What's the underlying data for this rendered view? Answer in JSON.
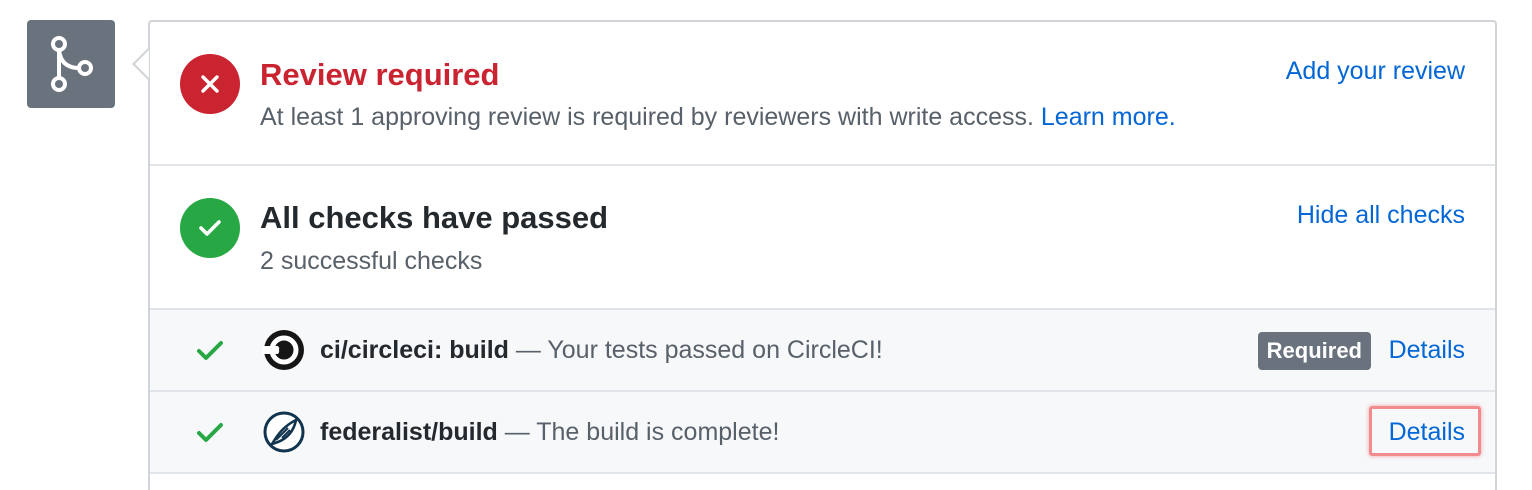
{
  "merge_icon": "git-merge-icon",
  "review": {
    "status_icon": "x-icon",
    "status_color": "#cb2431",
    "title": "Review required",
    "subtitle": "At least 1 approving review is required by reviewers with write access.",
    "learn_more": "Learn more.",
    "action": "Add your review"
  },
  "checks": {
    "status_icon": "check-icon",
    "status_color": "#28a745",
    "title": "All checks have passed",
    "subtitle": "2 successful checks",
    "action": "Hide all checks",
    "items": [
      {
        "avatar_icon": "circleci-logo-icon",
        "context": "ci/circleci: build",
        "description": "— Your tests passed on CircleCI!",
        "badge": "Required",
        "details": "Details"
      },
      {
        "avatar_icon": "federalist-logo-icon",
        "context": "federalist/build",
        "description": "— The build is complete!",
        "details": "Details"
      }
    ]
  },
  "colors": {
    "link": "#0366d6",
    "tile": "#6a737d",
    "border": "#d1d5da"
  }
}
